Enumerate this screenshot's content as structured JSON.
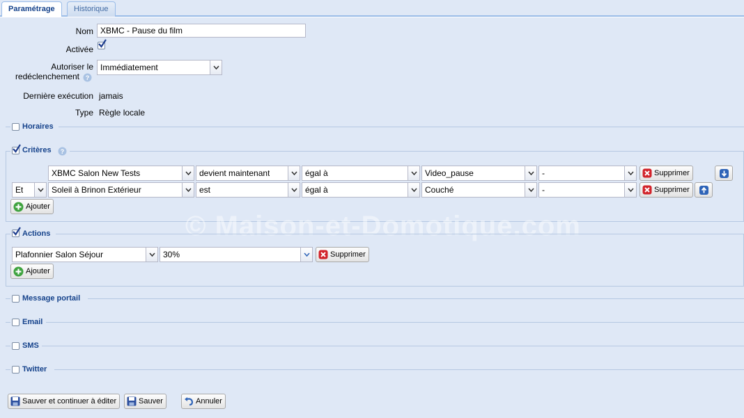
{
  "tabs": [
    {
      "label": "Paramétrage",
      "active": true
    },
    {
      "label": "Historique",
      "active": false
    }
  ],
  "form": {
    "nom_label": "Nom",
    "nom_value": "XBMC - Pause du film",
    "activee_label": "Activée",
    "activee_checked": true,
    "autoriser_label_1": "Autoriser le",
    "autoriser_label_2": "redéclenchement",
    "autoriser_value": "Immédiatement",
    "derniere_label": "Dernière exécution",
    "derniere_value": "jamais",
    "type_label": "Type",
    "type_value": "Règle locale"
  },
  "sections": {
    "horaires": {
      "label": "Horaires",
      "checked": false
    },
    "criteres": {
      "label": "Critères",
      "checked": true
    },
    "actions": {
      "label": "Actions",
      "checked": true
    },
    "message_portail": {
      "label": "Message portail",
      "checked": false
    },
    "email": {
      "label": "Email",
      "checked": false
    },
    "sms": {
      "label": "SMS",
      "checked": false
    },
    "twitter": {
      "label": "Twitter",
      "checked": false
    }
  },
  "criteria": [
    {
      "connector": "",
      "device": "XBMC Salon New Tests",
      "operator": "devient maintenant",
      "comparison": "égal à",
      "value": "Video_pause",
      "extra": "-",
      "delete_label": "Supprimer",
      "move": "down"
    },
    {
      "connector": "Et",
      "device": "Soleil à Brinon Extérieur",
      "operator": "est",
      "comparison": "égal à",
      "value": "Couché",
      "extra": "-",
      "delete_label": "Supprimer",
      "move": "up"
    }
  ],
  "criteria_add_label": "Ajouter",
  "actions": [
    {
      "device": "Plafonnier Salon Séjour",
      "value": "30%",
      "delete_label": "Supprimer"
    }
  ],
  "actions_add_label": "Ajouter",
  "footer": {
    "save_continue_label": "Sauver et continuer à éditer",
    "save_label": "Sauver",
    "cancel_label": "Annuler"
  },
  "watermark": "© Maison-et-Domotique.com",
  "colors": {
    "accent": "#15428b",
    "background": "#dfe8f6",
    "border": "#99bbe8"
  }
}
